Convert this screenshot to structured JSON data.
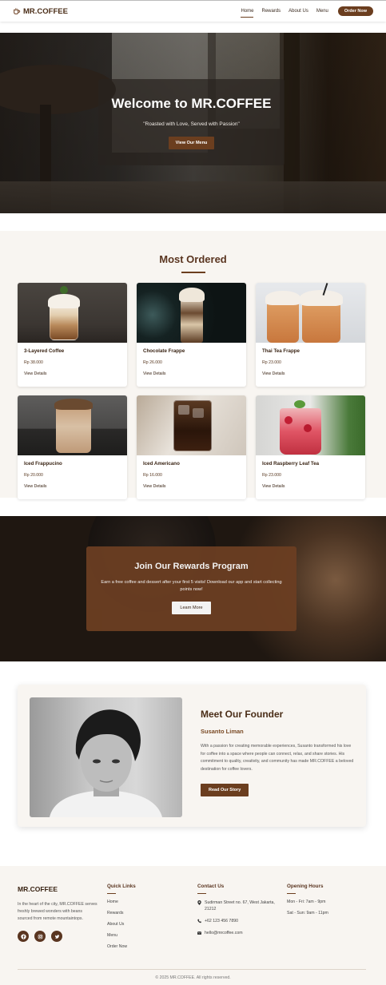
{
  "nav": {
    "brand": "MR.COFFEE",
    "links": [
      "Home",
      "Rewards",
      "About Us",
      "Menu"
    ],
    "order_btn": "Order Now"
  },
  "hero": {
    "title": "Welcome to MR.COFFEE",
    "subtitle": "\"Roasted with Love, Served with Passion\"",
    "button": "View Our Menu"
  },
  "most_ordered": {
    "title": "Most Ordered",
    "link_label": "View Details",
    "items": [
      {
        "name": "3-Layered Coffee",
        "price": "Rp 38.000"
      },
      {
        "name": "Chocolate Frappe",
        "price": "Rp 26.000"
      },
      {
        "name": "Thai Tea Frappe",
        "price": "Rp 23.000"
      },
      {
        "name": "Iced Frappucino",
        "price": "Rp 20.000"
      },
      {
        "name": "Iced Americano",
        "price": "Rp 16.000"
      },
      {
        "name": "Iced Raspberry Leaf Tea",
        "price": "Rp 23.000"
      }
    ]
  },
  "rewards": {
    "title": "Join Our Rewards Program",
    "text": "Earn a free coffee and dessert after your first 5 visits! Download our app and start collecting points now!",
    "button": "Learn More"
  },
  "founder": {
    "title": "Meet Our Founder",
    "name": "Susanto Liman",
    "text": "With a passion for creating memorable experiences, Susanto transformed his love for coffee into a space where people can connect, relax, and share stories. His commitment to quality, creativity, and community has made MR.COFFEE a beloved destination for coffee lovers.",
    "button": "Read Our Story"
  },
  "footer": {
    "brand": "MR.COFFEE",
    "description": "In the heart of the city, MR.COFFEE serves freshly brewed wonders with beans sourced from remote mountaintops.",
    "quick_links_title": "Quick Links",
    "quick_links": [
      "Home",
      "Rewards",
      "About Us",
      "Menu",
      "Order Now"
    ],
    "contact_title": "Contact Us",
    "address": "Sudirman Street no. 67, West Jakarta, 21212",
    "phone": "+62 123 456 7890",
    "email": "hello@mrcoffee.com",
    "hours_title": "Opening Hours",
    "hours_weekday": "Mon - Fri: 7am - 9pm",
    "hours_weekend": "Sat - Sun: 9am - 11pm",
    "copyright": "© 2025 MR.COFFEE. All rights reserved."
  },
  "colors": {
    "brand_brown": "#6b3e1f",
    "dark_brown": "#4a2d17",
    "cream_bg": "#f8f5f1"
  }
}
